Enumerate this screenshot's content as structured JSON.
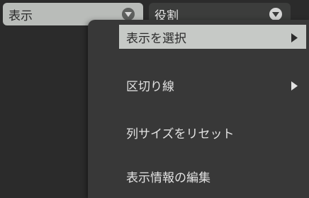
{
  "toolbar": {
    "display_dropdown": {
      "value": "表示",
      "icon": "chevron-down-icon"
    },
    "role_dropdown": {
      "value": "役割",
      "icon": "chevron-down-icon"
    }
  },
  "context_menu": {
    "items": [
      {
        "label": "表示を選択",
        "has_submenu": true,
        "selected": true
      },
      {
        "label": "区切り線",
        "has_submenu": true,
        "selected": false
      },
      {
        "label": "列サイズをリセット",
        "has_submenu": false,
        "selected": false
      },
      {
        "label": "表示情報の編集",
        "has_submenu": false,
        "selected": false
      }
    ]
  },
  "colors": {
    "background": "#2b2b2b",
    "menu_background": "#383838",
    "highlight": "#c6c9c6",
    "menu_text": "#e2e2e2"
  }
}
